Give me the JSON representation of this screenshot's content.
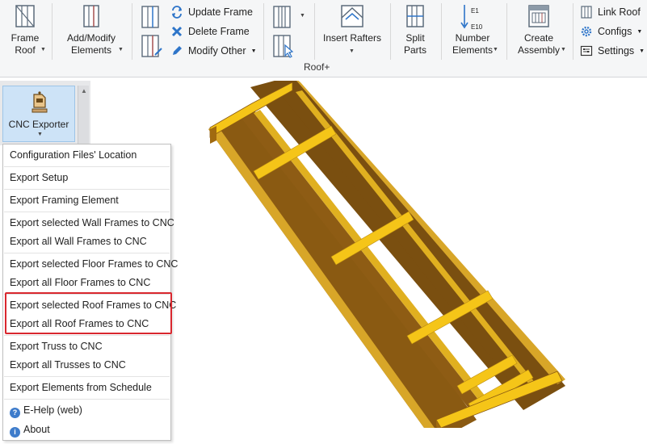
{
  "ribbon": {
    "group_label": "Roof+",
    "frame_roof": {
      "line1": "Frame",
      "line2": "Roof"
    },
    "add_modify": {
      "line1": "Add/Modify",
      "line2": "Elements"
    },
    "update_frame": "Update Frame",
    "delete_frame": "Delete Frame",
    "modify_other": "Modify Other",
    "insert_rafters": "Insert Rafters",
    "split_parts": {
      "line1": "Split",
      "line2": "Parts"
    },
    "number_elements": {
      "line1": "Number",
      "line2": "Elements"
    },
    "number_icon_top": "E1",
    "number_icon_bottom": "E10",
    "create_assembly": {
      "line1": "Create",
      "line2": "Assembly"
    },
    "link_roof": "Link Roof",
    "configs": "Configs",
    "settings": "Settings"
  },
  "panel": {
    "cnc_exporter": "CNC Exporter"
  },
  "menu": {
    "items": [
      "Configuration Files' Location",
      "Export Setup",
      "Export Framing Element",
      "Export selected Wall Frames to CNC",
      "Export all Wall Frames to CNC",
      "Export selected Floor Frames to CNC",
      "Export all Floor Frames to CNC",
      "Export selected Roof Frames to CNC",
      "Export all Roof Frames to CNC",
      "Export Truss to CNC",
      "Export all Trusses to CNC",
      "Export Elements from Schedule",
      "E-Help (web)",
      "About"
    ]
  },
  "colors": {
    "highlight_border": "#d9272e",
    "timber_dark": "#8a5a12",
    "timber_light": "#f5c518",
    "accent_blue": "#2e75c9"
  }
}
